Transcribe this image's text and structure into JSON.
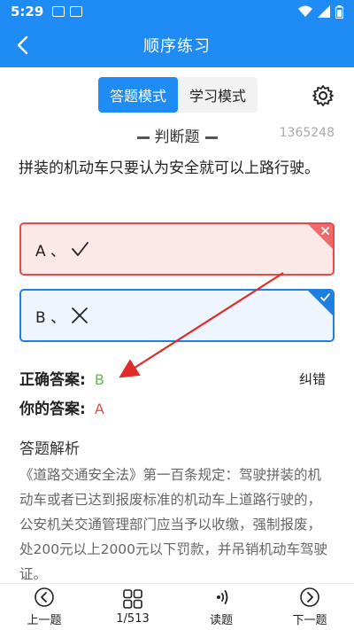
{
  "status": {
    "time": "5:29"
  },
  "app_bar": {
    "title": "顺序练习"
  },
  "modes": [
    {
      "label": "答题模式",
      "active": true
    },
    {
      "label": "学习模式",
      "active": false
    }
  ],
  "question": {
    "type": "判断题",
    "id": "1365248",
    "text": "拼装的机动车只要认为安全就可以上路行驶。",
    "options": [
      {
        "label": "A 、",
        "mark": "check",
        "state": "wrong"
      },
      {
        "label": "B 、",
        "mark": "cross",
        "state": "correct"
      }
    ]
  },
  "answers": {
    "correct_label": "正确答案",
    "correct_value": "B",
    "yours_label": "你的答案",
    "yours_value": "A",
    "report_label": "纠错",
    "separator": ":"
  },
  "analysis": {
    "title": "答题解析",
    "text": "《道路交通安全法》第一百条规定：驾驶拼装的机动车或者已达到报废标准的机动车上道路行驶的，公安机关交通管理部门应当予以收缴，强制报废，处200元以上2000元以下罚款，并吊销机动车驾驶证。"
  },
  "bottom_nav": {
    "prev": "上一题",
    "progress": "1/513",
    "read": "读题",
    "next": "下一题"
  },
  "colors": {
    "primary": "#1f8bf5",
    "wrong": "#e84a4a",
    "correct_text": "#5cbf3a",
    "annotation_arrow": "#e02b2b"
  }
}
